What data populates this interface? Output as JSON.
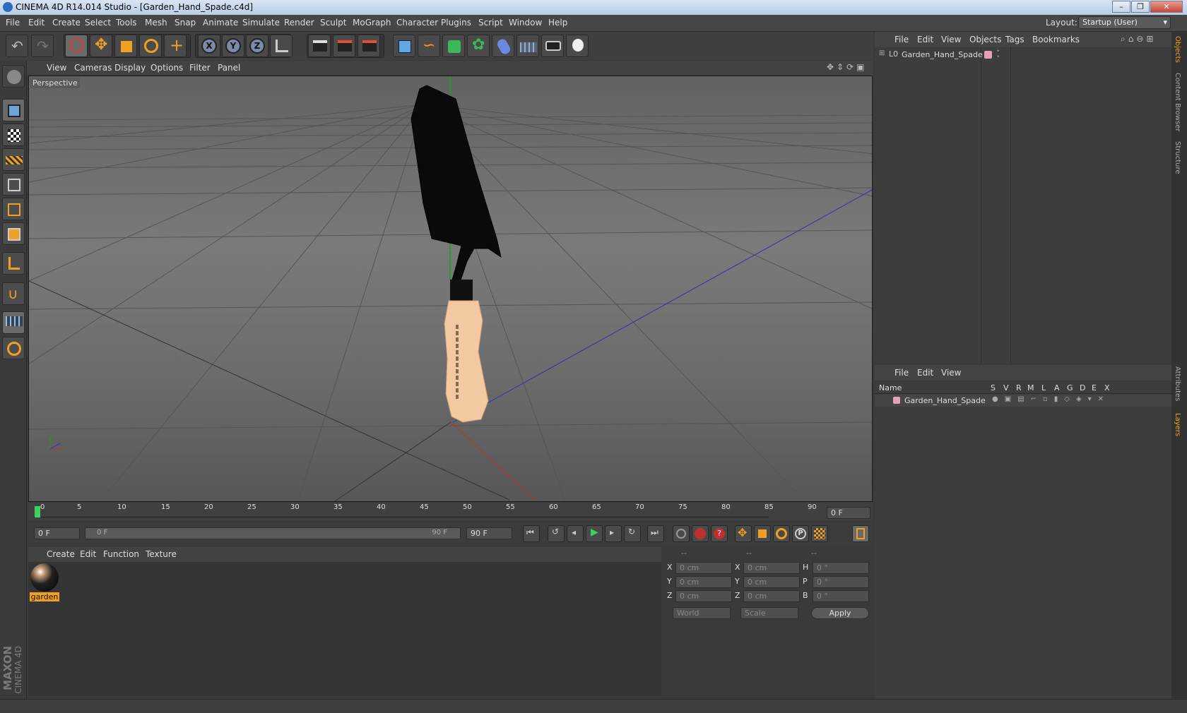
{
  "window": {
    "title": "CINEMA 4D R14.014 Studio - [Garden_Hand_Spade.c4d]",
    "min": "–",
    "max": "❐",
    "close": "✕"
  },
  "menubar": {
    "items": [
      "File",
      "Edit",
      "Create",
      "Select",
      "Tools",
      "Mesh",
      "Snap",
      "Animate",
      "Simulate",
      "Render",
      "Sculpt",
      "MoGraph",
      "Character",
      "Plugins",
      "Script",
      "Window",
      "Help"
    ],
    "layout_label": "Layout:",
    "layout_value": "Startup (User)"
  },
  "viewport": {
    "menu": [
      "View",
      "Cameras",
      "Display",
      "Options",
      "Filter",
      "Panel"
    ],
    "label": "Perspective"
  },
  "timeline": {
    "ticks": [
      "0",
      "5",
      "10",
      "15",
      "20",
      "25",
      "30",
      "35",
      "40",
      "45",
      "50",
      "55",
      "60",
      "65",
      "70",
      "75",
      "80",
      "85",
      "90"
    ],
    "frame_field": "0 F"
  },
  "transport": {
    "start": "0 F",
    "slider_start": "0 F",
    "slider_end": "90 F",
    "end": "90 F"
  },
  "materials": {
    "menu": [
      "Create",
      "Edit",
      "Function",
      "Texture"
    ],
    "items": [
      {
        "label": "garden"
      }
    ]
  },
  "coordinates": {
    "headers": [
      "--",
      "--",
      "--"
    ],
    "rows": [
      {
        "axis": "X",
        "pos": "0 cm",
        "size_axis": "X",
        "size": "0 cm",
        "rot_axis": "H",
        "rot": "0 °"
      },
      {
        "axis": "Y",
        "pos": "0 cm",
        "size_axis": "Y",
        "size": "0 cm",
        "rot_axis": "P",
        "rot": "0 °"
      },
      {
        "axis": "Z",
        "pos": "0 cm",
        "size_axis": "Z",
        "size": "0 cm",
        "rot_axis": "B",
        "rot": "0 °"
      }
    ],
    "world": "World",
    "scale": "Scale",
    "apply": "Apply"
  },
  "objects": {
    "menu": [
      "File",
      "Edit",
      "View",
      "Objects",
      "Tags",
      "Bookmarks"
    ],
    "items": [
      {
        "name": "Garden_Hand_Spade"
      }
    ]
  },
  "layers": {
    "menu": [
      "File",
      "Edit",
      "View"
    ],
    "name_header": "Name",
    "cols": [
      "S",
      "V",
      "R",
      "M",
      "L",
      "A",
      "G",
      "D",
      "E",
      "X"
    ],
    "items": [
      {
        "name": "Garden_Hand_Spade"
      }
    ]
  },
  "sidetabs": [
    "Objects",
    "Content Browser",
    "Structure",
    "Attributes",
    "Layers"
  ],
  "branding": {
    "maxon": "MAXON",
    "cinema": "CINEMA 4D"
  },
  "colors": {
    "accent": "#f0a020",
    "layer": "#e8a0b4",
    "bg": "#3a3a3a"
  }
}
